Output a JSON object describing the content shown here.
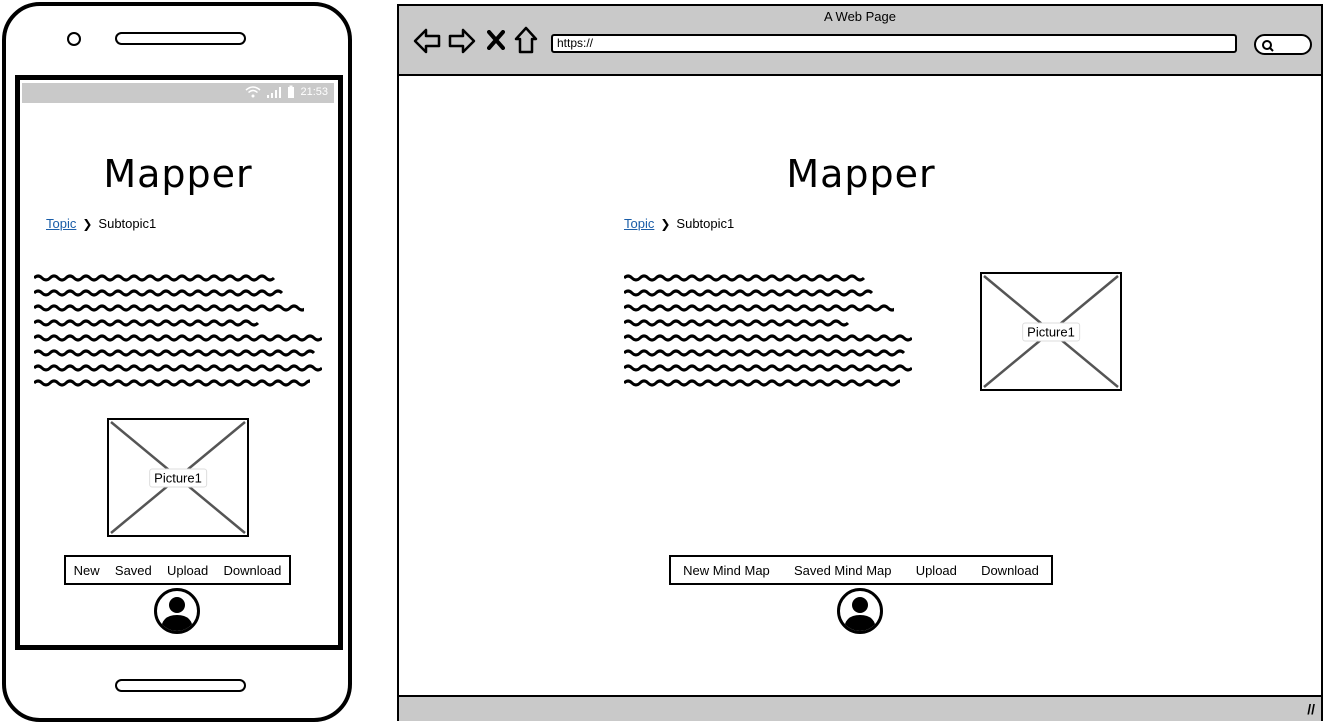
{
  "phone": {
    "status_time": "21:53",
    "title": "Mapper",
    "breadcrumb": {
      "link": "Topic",
      "current": "Subtopic1"
    },
    "picture_label": "Picture1",
    "menu": [
      "New",
      "Saved",
      "Upload",
      "Download"
    ]
  },
  "browser": {
    "window_title": "A Web Page",
    "url": "https://",
    "nav_icons": [
      "back-arrow-icon",
      "forward-arrow-icon",
      "close-x-icon",
      "home-icon"
    ],
    "title": "Mapper",
    "breadcrumb": {
      "link": "Topic",
      "current": "Subtopic1"
    },
    "picture_label": "Picture1",
    "menu": [
      "New Mind Map",
      "Saved Mind Map",
      "Upload",
      "Download"
    ]
  }
}
